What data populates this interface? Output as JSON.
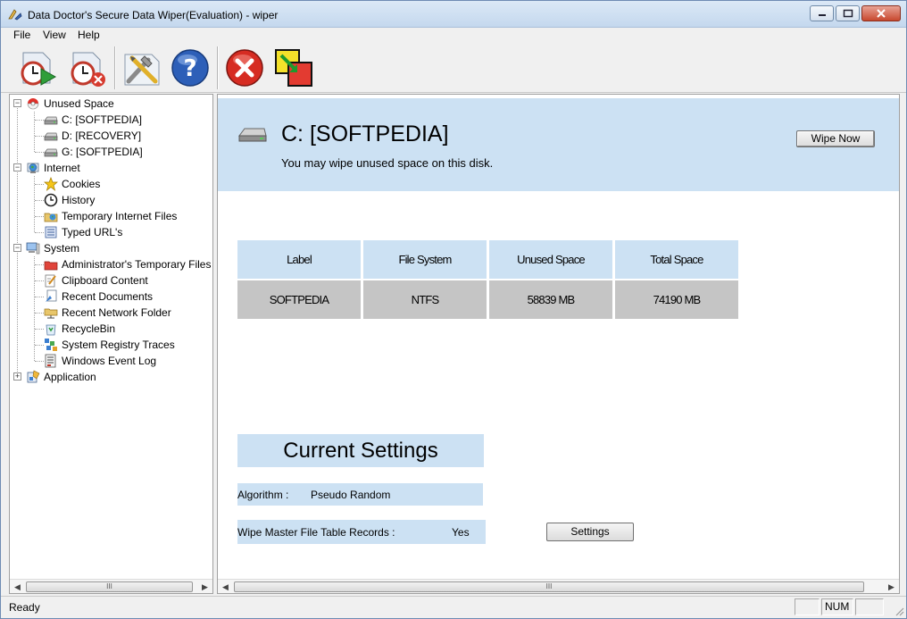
{
  "window": {
    "title": "Data Doctor's Secure Data Wiper(Evaluation) - wiper"
  },
  "menu": {
    "items": [
      "File",
      "View",
      "Help"
    ]
  },
  "toolbar": {
    "buttons": [
      {
        "icon": "schedule-wipe-icon"
      },
      {
        "icon": "cancel-schedule-icon"
      },
      {
        "icon": "settings-tools-icon"
      },
      {
        "icon": "help-icon"
      },
      {
        "icon": "exit-icon"
      },
      {
        "icon": "switch-icon"
      }
    ]
  },
  "tree": {
    "unused_space": {
      "label": "Unused Space",
      "children": [
        "C: [SOFTPEDIA]",
        "D: [RECOVERY]",
        "G: [SOFTPEDIA]"
      ]
    },
    "internet": {
      "label": "Internet",
      "children": [
        "Cookies",
        "History",
        "Temporary Internet Files",
        "Typed URL's"
      ]
    },
    "system": {
      "label": "System",
      "children": [
        "Administrator's Temporary Files",
        "Clipboard Content",
        "Recent Documents",
        "Recent Network Folder",
        "RecycleBin",
        "System Registry Traces",
        "Windows Event Log"
      ]
    },
    "application": {
      "label": "Application"
    }
  },
  "content": {
    "disk_title": "C: [SOFTPEDIA]",
    "disk_subtitle": "You may wipe unused space on this disk.",
    "wipe_button": "Wipe Now",
    "table": {
      "headers": [
        "Label",
        "File System",
        "Unused Space",
        "Total Space"
      ],
      "values": [
        "SOFTPEDIA",
        "NTFS",
        "58839 MB",
        "74190 MB"
      ]
    },
    "settings": {
      "title": "Current Settings",
      "algorithm_label": "Algorithm :",
      "algorithm_value": "Pseudo Random",
      "mft_label": "Wipe Master File Table Records :",
      "mft_value": "Yes",
      "settings_button": "Settings"
    }
  },
  "statusbar": {
    "text": "Ready",
    "num": "NUM"
  },
  "scrollbar": {
    "thumb_grip": "III"
  },
  "colors": {
    "header_band": "#cce1f3",
    "value_row": "#c5c5c5"
  }
}
